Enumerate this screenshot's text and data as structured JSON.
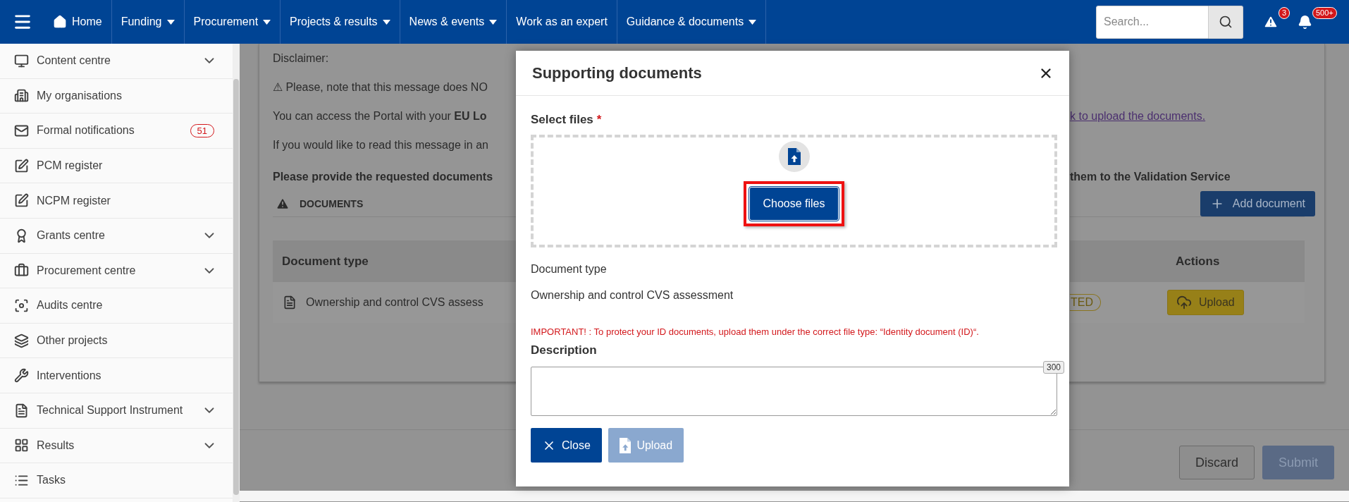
{
  "navbar": {
    "items": [
      {
        "label": "Home",
        "kind": "home"
      },
      {
        "label": "Funding",
        "kind": "dropdown"
      },
      {
        "label": "Procurement",
        "kind": "dropdown"
      },
      {
        "label": "Projects & results",
        "kind": "dropdown"
      },
      {
        "label": "News & events",
        "kind": "dropdown"
      },
      {
        "label": "Work as an expert",
        "kind": "link"
      },
      {
        "label": "Guidance & documents",
        "kind": "dropdown"
      }
    ],
    "search": {
      "placeholder": "Search..."
    },
    "alerts_count": "3",
    "notifications_count": "500+"
  },
  "sidebar": {
    "items": [
      {
        "label": "Content centre",
        "expandable": true
      },
      {
        "label": "My organisations",
        "expandable": false
      },
      {
        "label": "Formal notifications",
        "expandable": false,
        "badge": "51"
      },
      {
        "label": "PCM register",
        "expandable": false
      },
      {
        "label": "NCPM register",
        "expandable": false
      },
      {
        "label": "Grants centre",
        "expandable": true
      },
      {
        "label": "Procurement centre",
        "expandable": true
      },
      {
        "label": "Audits centre",
        "expandable": false
      },
      {
        "label": "Other projects",
        "expandable": false
      },
      {
        "label": "Interventions",
        "expandable": false
      },
      {
        "label": "Technical Support Instrument",
        "expandable": true
      },
      {
        "label": "Results",
        "expandable": true
      },
      {
        "label": "Tasks",
        "expandable": false
      }
    ]
  },
  "message": {
    "left_lines": [
      "Disclaimer:",
      "⚠ Please, note that this message does NO",
      "You can access the Portal with your **EU Lo**",
      "If you would like to read this message in an"
    ],
    "right_link": "k to upload the documents.",
    "request_left": "Please provide the requested documents",
    "request_right": "them to the Validation Service",
    "section_title": "DOCUMENTS",
    "add_button": "Add document",
    "table": {
      "columns": [
        "Document type",
        "Actions"
      ],
      "rows": [
        {
          "document_type": "Ownership and control CVS assess",
          "status": "TED",
          "action": "Upload"
        }
      ]
    }
  },
  "footer_buttons": [
    {
      "label": "Discard",
      "kind": "secondary",
      "disabled": false
    },
    {
      "label": "Submit",
      "kind": "primary",
      "disabled": true
    }
  ],
  "modal": {
    "title": "Supporting documents",
    "select_label": "Select files",
    "required_mark": "*",
    "choose_button": "Choose files",
    "highlighted": true,
    "document_type_label": "Document type",
    "document_type": "Ownership and control CVS assessment",
    "warning": "IMPORTANT! : To protect your ID documents, upload them under the correct file type: “Identity document (ID)“.",
    "description_label": "Description",
    "char_counter": "300",
    "buttons": [
      {
        "label": "Close",
        "kind": "close",
        "disabled": false
      },
      {
        "label": "Upload",
        "kind": "upload",
        "disabled": true
      }
    ]
  }
}
